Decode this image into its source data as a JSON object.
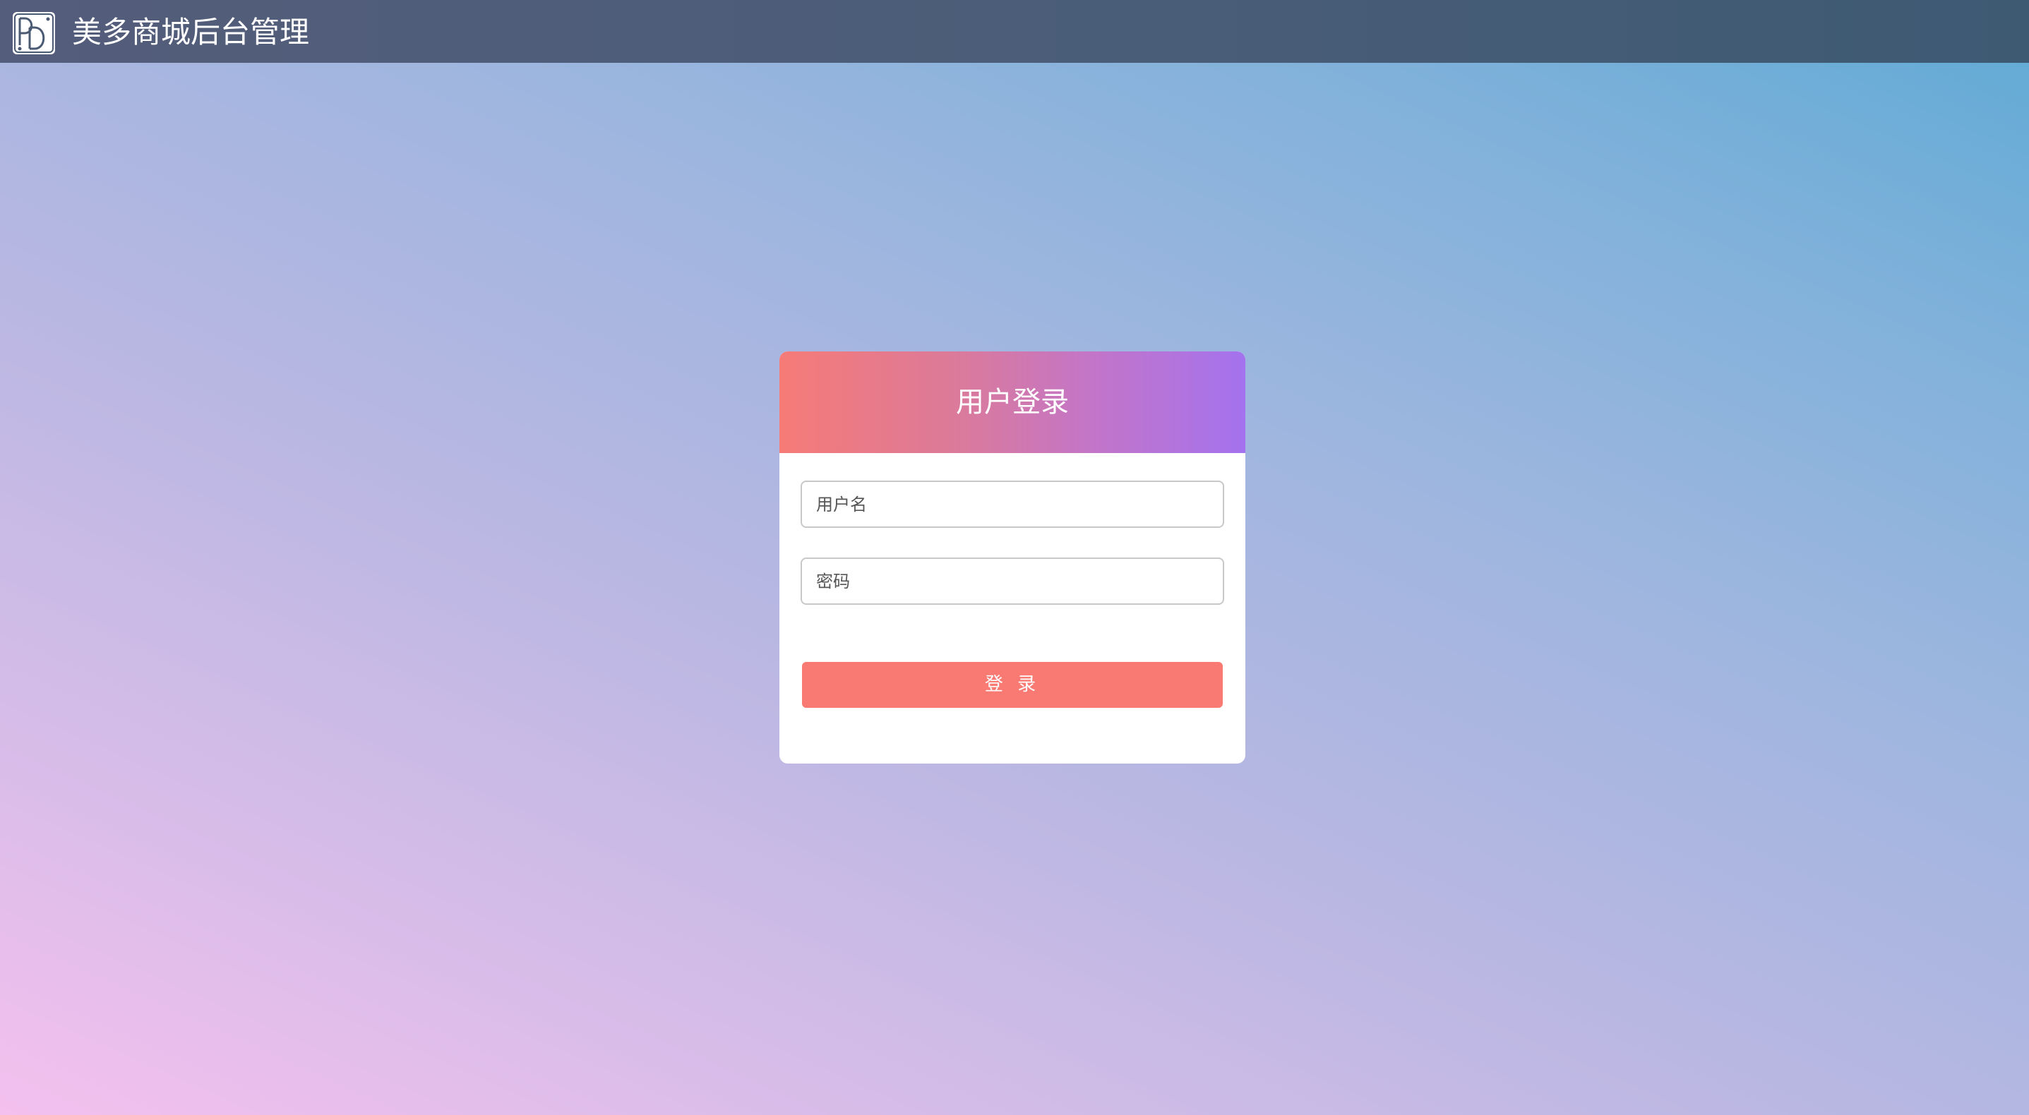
{
  "header": {
    "title": "美多商城后台管理",
    "logo_icon": "dd-logo-icon"
  },
  "login": {
    "title": "用户登录",
    "username_placeholder": "用户名",
    "username_value": "",
    "password_placeholder": "密码",
    "password_value": "",
    "submit_label": "登 录"
  },
  "colors": {
    "topbar": "#4a5d78",
    "card_header_start": "#f67b77",
    "card_header_end": "#a472ee",
    "button": "#f97a72"
  }
}
